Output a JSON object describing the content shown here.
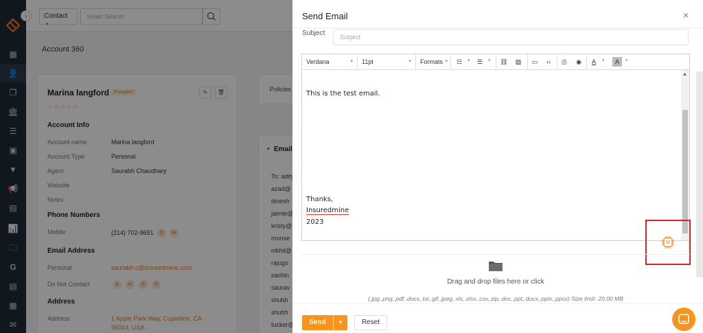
{
  "topbar": {
    "contact_select": "Contact",
    "search_placeholder": "Smart Search"
  },
  "page": {
    "title": "Account 360"
  },
  "account": {
    "name": "Marina langford",
    "badge": "Prospect",
    "rating": "☆☆☆☆☆",
    "sections": {
      "info": "Account Info",
      "phone": "Phone Numbers",
      "email": "Email Address",
      "address": "Address"
    },
    "fields": {
      "account_name_label": "Account name",
      "account_name": "Marina langford",
      "account_type_label": "Account Type",
      "account_type": "Personal",
      "agent_label": "Agent",
      "agent": "Saurabh Chaudhary",
      "website_label": "Website",
      "notes_label": "Notes",
      "mobile_label": "Mobile",
      "mobile": "(214) 702-9691",
      "personal_label": "Personal",
      "personal_email": "saurabh.c@insuredmine.com",
      "dnc_label": "Do Not Contact",
      "address_label": "Address",
      "address_line1": "1 Apple Park Way, Cupertino, CA",
      "address_line2": "95014, USA"
    }
  },
  "policies_tab": "Policies",
  "email_panel": {
    "title": "Email",
    "lines": [
      "To: adity",
      "azad@",
      "dinesh",
      "jaimie@",
      "kristy@",
      "monse",
      "nikhil@",
      "rajugo",
      "sachin",
      "saurav",
      "shubh",
      "shubh",
      "tucker@"
    ]
  },
  "modal": {
    "title": "Send Email",
    "close_icon": "×",
    "subject_label": "Subject",
    "subject_placeholder": "Subject",
    "toolbar": {
      "font": "Verdana",
      "size": "11pt",
      "formats": "Formats"
    },
    "body": {
      "line1": "This is the test email.",
      "thanks": "Thanks,",
      "company": "Insuredmine",
      "year": "2023"
    },
    "ai_label": "AI",
    "dropzone": {
      "title": "Drag and drop files here or click",
      "subtitle": "(.jpg,.png,.pdf,.docx,.txt,.gif,.jpeg,.xls,.xlsx,.csv,.zip,.doc,.ppt,.docx,.pptx,.ppsx) Size limit- 20.00 MB"
    },
    "send_label": "Send",
    "reset_label": "Reset"
  },
  "colors": {
    "accent": "#f7931e",
    "sidebar": "#1e2a36",
    "highlight_box": "#e02020"
  }
}
